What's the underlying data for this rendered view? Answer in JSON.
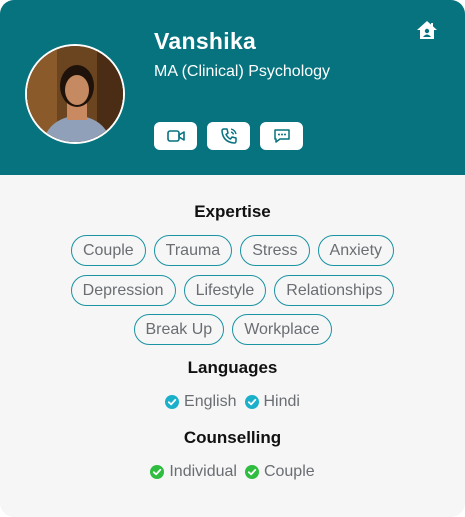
{
  "profile": {
    "name": "Vanshika",
    "degree": "MA (Clinical) Psychology",
    "avatar_icon": "profile-photo"
  },
  "header": {
    "home_icon": "home-icon",
    "background_color": "#06737f"
  },
  "actions": [
    {
      "icon": "video-call-icon"
    },
    {
      "icon": "phone-call-icon"
    },
    {
      "icon": "chat-icon"
    }
  ],
  "expertise": {
    "title": "Expertise",
    "tags": [
      "Couple",
      "Trauma",
      "Stress",
      "Anxiety",
      "Depression",
      "Lifestyle",
      "Relationships",
      "Break Up",
      "Workplace"
    ]
  },
  "languages": {
    "title": "Languages",
    "items": [
      "English",
      "Hindi"
    ],
    "check_color": "#1bb0c9"
  },
  "counselling": {
    "title": "Counselling",
    "items": [
      "Individual",
      "Couple"
    ],
    "check_color": "#2ebd3f"
  }
}
